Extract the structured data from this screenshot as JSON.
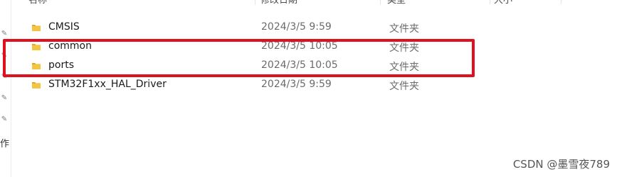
{
  "header": {
    "name": "名称",
    "date_modified": "修改日期",
    "type": "类型",
    "size": "大小"
  },
  "files": [
    {
      "name": "CMSIS",
      "date_modified": "2024/3/5 9:59",
      "type": "文件夹",
      "icon": "folder-icon"
    },
    {
      "name": "common",
      "date_modified": "2024/3/5 10:05",
      "type": "文件夹",
      "icon": "folder-icon"
    },
    {
      "name": "ports",
      "date_modified": "2024/3/5 10:05",
      "type": "文件夹",
      "icon": "folder-icon"
    },
    {
      "name": "STM32F1xx_HAL_Driver",
      "date_modified": "2024/3/5 9:59",
      "type": "文件夹",
      "icon": "folder-icon"
    }
  ],
  "left_panel": {
    "partial_text": "作"
  },
  "annotation": {
    "highlight_color": "#e0101e"
  },
  "watermark": "CSDN @墨雪夜789",
  "colors": {
    "folder": "#f4c542",
    "folder_dark": "#e2a81f"
  }
}
